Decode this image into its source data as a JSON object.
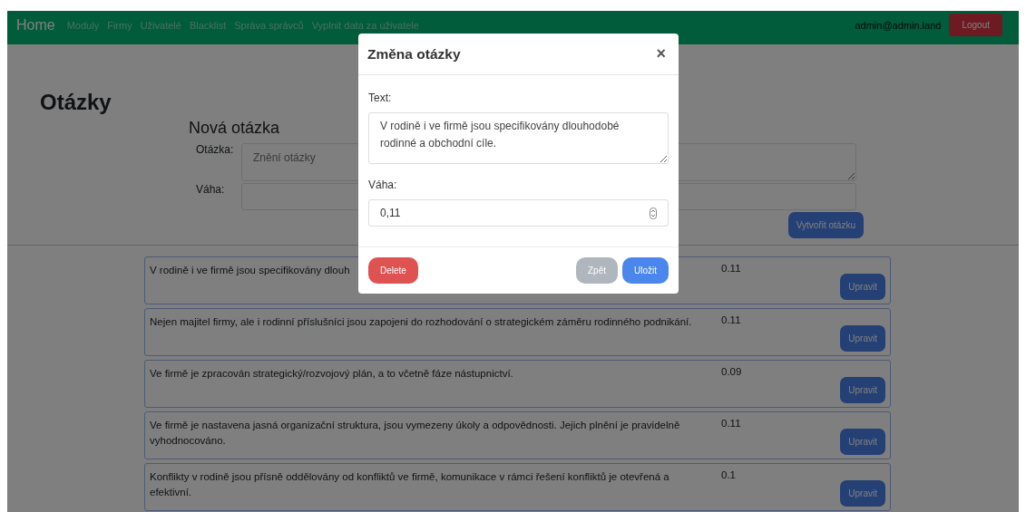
{
  "navbar": {
    "brand": "Home",
    "links": [
      "Moduly",
      "Firmy",
      "Uživatelé",
      "Blacklist",
      "Správa správců",
      "Vyplnit data za uživatele"
    ],
    "user": "admin@admin.land",
    "logout": "Logout"
  },
  "page": {
    "title": "Otázky",
    "new_question": {
      "heading": "Nová otázka",
      "fields": [
        {
          "kind": "textarea",
          "label": "Otázka:",
          "placeholder": "Znění otázky"
        },
        {
          "kind": "input",
          "label": "Váha:"
        }
      ],
      "submit": "Vytvořit otázku"
    }
  },
  "questions": [
    {
      "text": "V rodině i ve firmě jsou specifikovány dlouh",
      "weight": "0.11",
      "button": "Upravit"
    },
    {
      "text": "Nejen majitel firmy, ale i rodinní příslušníci jsou zapojeni do rozhodování o strategickém záměru rodinného podnikání.",
      "weight": "0.11",
      "button": "Upravit"
    },
    {
      "text": "Ve firmě je zpracován strategický/rozvojový plán, a to včetně fáze nástupnictví.",
      "weight": "0.09",
      "button": "Upravit"
    },
    {
      "text": "Ve firmě je nastavena jasná organizační struktura, jsou vymezeny úkoly a odpovědnosti. Jejich plnění je pravidelně vyhodnocováno.",
      "weight": "0.11",
      "button": "Upravit"
    },
    {
      "text": "Konflikty v rodině jsou přísně oddělovány od konfliktů ve firmě, komunikace v rámci řešení konfliktů je otevřená a efektivní.",
      "weight": "0.1",
      "button": "Upravit"
    }
  ],
  "modal": {
    "title": "Změna otázky",
    "close": "×",
    "text_label": "Text:",
    "text_value": "V rodině i ve firmě jsou specifikovány dlouhodobé rodinné a obchodní cíle.",
    "weight_label": "Váha:",
    "weight_value": "0,11",
    "buttons": [
      {
        "kind": "danger",
        "label": "Delete"
      },
      {
        "kind": "secondary",
        "label": "Zpět"
      },
      {
        "kind": "primary",
        "label": "Uložit"
      }
    ]
  }
}
